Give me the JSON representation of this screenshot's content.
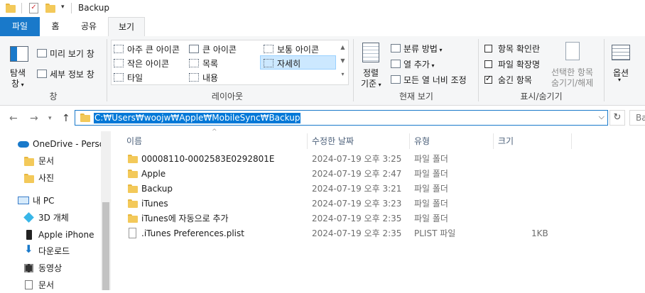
{
  "window": {
    "title": "Backup"
  },
  "ribbon_tabs": [
    "파일",
    "홈",
    "공유",
    "보기"
  ],
  "panes_group": {
    "nav_pane_label_line1": "탐색",
    "nav_pane_label_line2": "창",
    "preview_pane": "미리 보기 창",
    "details_pane": "세부 정보 창",
    "group_label": "창"
  },
  "layout_group": {
    "items": [
      "아주 큰 아이콘",
      "큰 아이콘",
      "보통 아이콘",
      "작은 아이콘",
      "목록",
      "자세히",
      "타일",
      "내용"
    ],
    "selected": "자세히",
    "group_label": "레이아웃"
  },
  "current_view_group": {
    "sort_line1": "정렬",
    "sort_line2": "기준",
    "group_by": "분류 방법",
    "add_columns": "열 추가",
    "size_all_columns": "모든 열 너비 조정",
    "group_label": "현재 보기"
  },
  "show_hide_group": {
    "item_checkboxes": {
      "label": "항목 확인란",
      "checked": false
    },
    "file_extensions": {
      "label": "파일 확장명",
      "checked": false
    },
    "hidden_items": {
      "label": "숨긴 항목",
      "checked": true
    },
    "hide_selected_line1": "선택한 항목",
    "hide_selected_line2": "숨기기/해제",
    "group_label": "표시/숨기기"
  },
  "options": {
    "label": "옵션"
  },
  "address": {
    "path": "C:₩Users₩woojw₩Apple₩MobileSync₩Backup"
  },
  "search": {
    "placeholder": "Ba"
  },
  "nav_pane": {
    "items": [
      "OneDrive - Perso",
      "문서",
      "사진",
      "내 PC",
      "3D 개체",
      "Apple iPhone",
      "다운로드",
      "동영상",
      "문서"
    ]
  },
  "columns": [
    "이름",
    "수정한 날짜",
    "유형",
    "크기"
  ],
  "files": [
    {
      "name": "00008110-0002583E0292801E",
      "date": "2024-07-19 오후 3:25",
      "type": "파일 폴더",
      "size": ""
    },
    {
      "name": "Apple",
      "date": "2024-07-19 오후 2:47",
      "type": "파일 폴더",
      "size": ""
    },
    {
      "name": "Backup",
      "date": "2024-07-19 오후 3:21",
      "type": "파일 폴더",
      "size": ""
    },
    {
      "name": "iTunes",
      "date": "2024-07-19 오후 3:23",
      "type": "파일 폴더",
      "size": ""
    },
    {
      "name": "iTunes에 자동으로 추가",
      "date": "2024-07-19 오후 2:35",
      "type": "파일 폴더",
      "size": ""
    },
    {
      "name": ".iTunes Preferences.plist",
      "date": "2024-07-19 오후 2:35",
      "type": "PLIST 파일",
      "size": "1KB"
    }
  ],
  "colors": {
    "accent": "#1979ca",
    "selection": "#cce8ff",
    "folder": "#f3c95a"
  }
}
